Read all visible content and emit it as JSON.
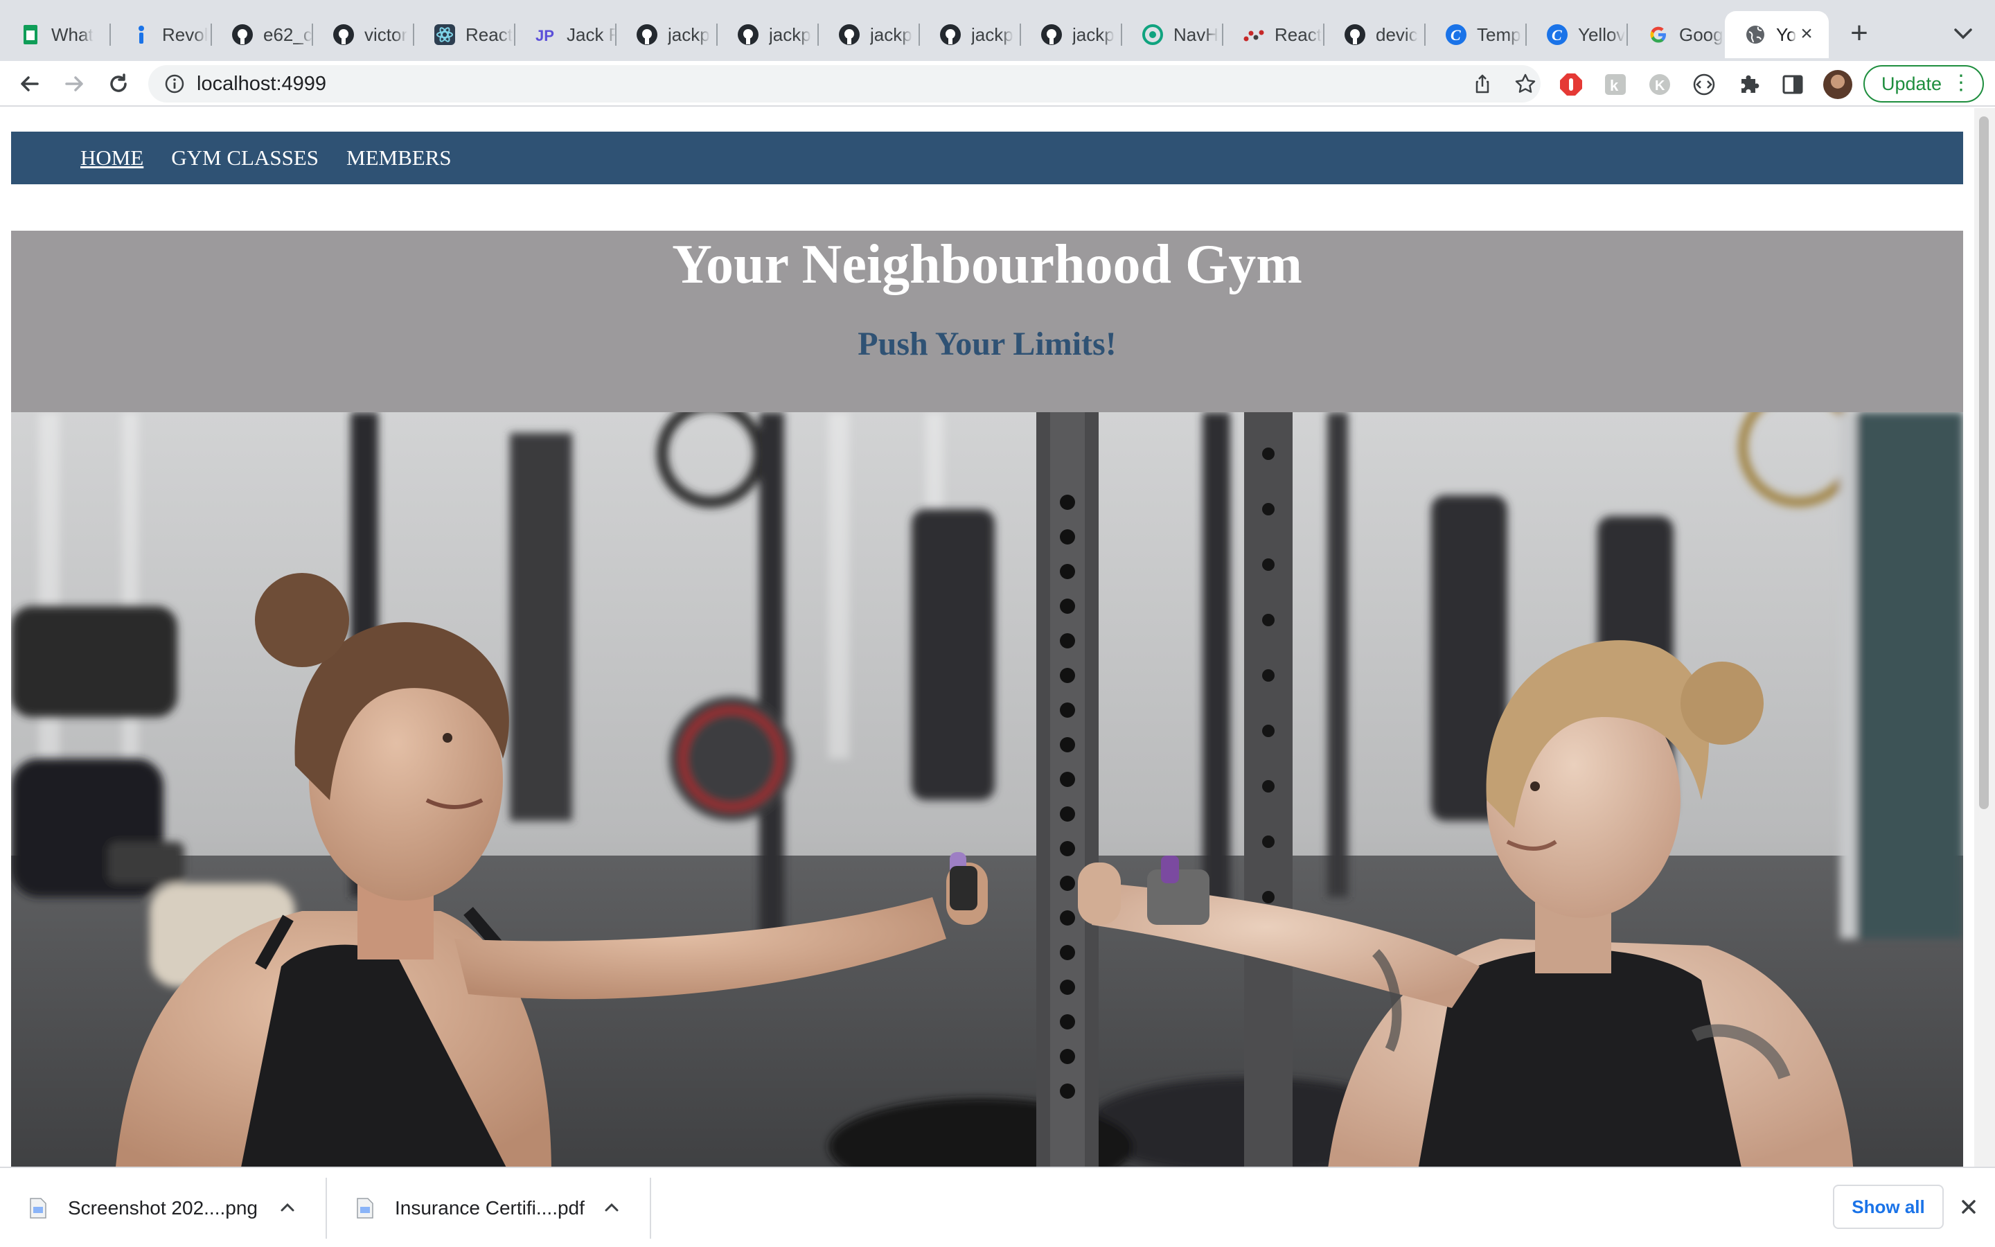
{
  "browser": {
    "tabs": [
      {
        "title": "What",
        "icon": "sheets-icon",
        "color": "#0f9d58"
      },
      {
        "title": "Revol",
        "icon": "revolut-icon",
        "color": "#1a73e8"
      },
      {
        "title": "e62_c",
        "icon": "github-icon",
        "color": "#24292f"
      },
      {
        "title": "victor",
        "icon": "github-icon",
        "color": "#24292f"
      },
      {
        "title": "React",
        "icon": "react-icon",
        "color": "#2d3e50"
      },
      {
        "title": "Jack F",
        "icon": "jp-icon",
        "color": "#5b4fd9"
      },
      {
        "title": "jackp",
        "icon": "github-icon",
        "color": "#24292f"
      },
      {
        "title": "jackp",
        "icon": "github-icon",
        "color": "#24292f"
      },
      {
        "title": "jackp",
        "icon": "github-icon",
        "color": "#24292f"
      },
      {
        "title": "jackp",
        "icon": "github-icon",
        "color": "#24292f"
      },
      {
        "title": "jackp",
        "icon": "github-icon",
        "color": "#24292f"
      },
      {
        "title": "NavH",
        "icon": "chatgpt-icon",
        "color": "#10a37f"
      },
      {
        "title": "React",
        "icon": "dots-icon",
        "color": "#c62828"
      },
      {
        "title": "devic",
        "icon": "github-icon",
        "color": "#24292f"
      },
      {
        "title": "Temp",
        "icon": "c-icon",
        "color": "#1a73e8"
      },
      {
        "title": "Yellov",
        "icon": "c-icon",
        "color": "#1a73e8"
      },
      {
        "title": "Goog",
        "icon": "google-icon",
        "color": "#4285f4"
      },
      {
        "title": "Yo",
        "icon": "globe-icon",
        "color": "#5f6368"
      }
    ],
    "address": "localhost:4999",
    "update_label": "Update"
  },
  "site": {
    "nav": [
      {
        "label": "HOME"
      },
      {
        "label": "GYM CLASSES"
      },
      {
        "label": "MEMBERS"
      }
    ],
    "title": "Your Neighbourhood Gym",
    "tagline": "Push Your Limits!"
  },
  "downloads": {
    "items": [
      {
        "name": "Screenshot 202....png"
      },
      {
        "name": "Insurance Certifi....pdf"
      }
    ],
    "show_all": "Show all"
  },
  "colors": {
    "nav_bg": "#2f5274",
    "hero_band_bg": "#9c9a9c",
    "tagline": "#2f5274",
    "update_accent": "#1e8e3e"
  }
}
